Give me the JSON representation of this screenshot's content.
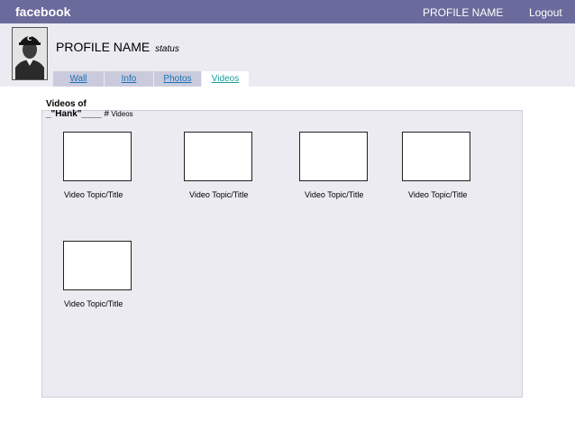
{
  "topbar": {
    "brand": "facebook",
    "profile_link": "PROFILE NAME",
    "logout": "Logout"
  },
  "profile": {
    "name": "PROFILE NAME",
    "status": "status"
  },
  "tabs": [
    {
      "label": "Wall",
      "active": false
    },
    {
      "label": "Info",
      "active": false
    },
    {
      "label": "Photos",
      "active": false
    },
    {
      "label": "Videos",
      "active": true
    }
  ],
  "videos_section": {
    "heading_line1": "Videos of",
    "heading_line2": "_\"Hank\"____",
    "count_hash": "#",
    "count_label": "Videos"
  },
  "videos": [
    {
      "title": "Video Topic/Title"
    },
    {
      "title": "Video Topic/Title"
    },
    {
      "title": "Video Topic/Title"
    },
    {
      "title": "Video Topic/Title"
    },
    {
      "title": "Video Topic/Title"
    }
  ]
}
